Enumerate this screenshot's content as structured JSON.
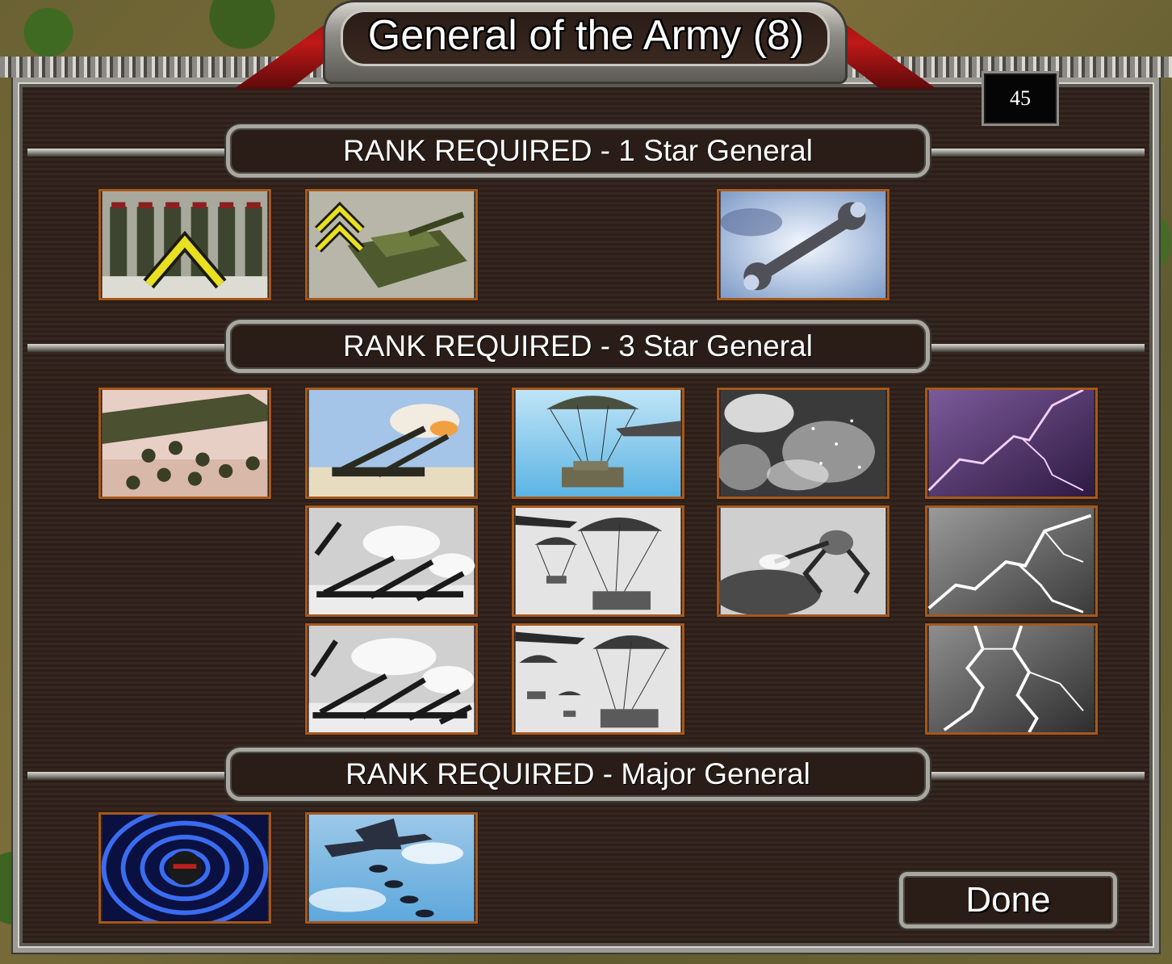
{
  "window": {
    "title": "General of the Army (8)",
    "points": "45"
  },
  "sections": [
    {
      "header": "RANK REQUIRED - 1 Star General"
    },
    {
      "header": "RANK REQUIRED - 3 Star General"
    },
    {
      "header": "RANK REQUIRED - Major General"
    }
  ],
  "powers": {
    "row1": [
      "infantry-veteran-icon",
      "tank-veteran-icon",
      "repair-wrench-icon"
    ],
    "row2": [
      "cluster-mines-icon",
      "artillery-barrage-1-icon",
      "paradrop-1-icon",
      "emp-sparks-icon",
      "lightning-storm-1-icon"
    ],
    "row3": [
      "artillery-barrage-2-icon",
      "paradrop-2-icon",
      "repair-drone-icon",
      "lightning-storm-2-icon"
    ],
    "row4": [
      "artillery-barrage-3-icon",
      "paradrop-3-icon",
      "lightning-storm-3-icon"
    ],
    "row5": [
      "emp-pulse-icon",
      "carpet-bomb-icon"
    ]
  },
  "buttons": {
    "done": "Done"
  }
}
